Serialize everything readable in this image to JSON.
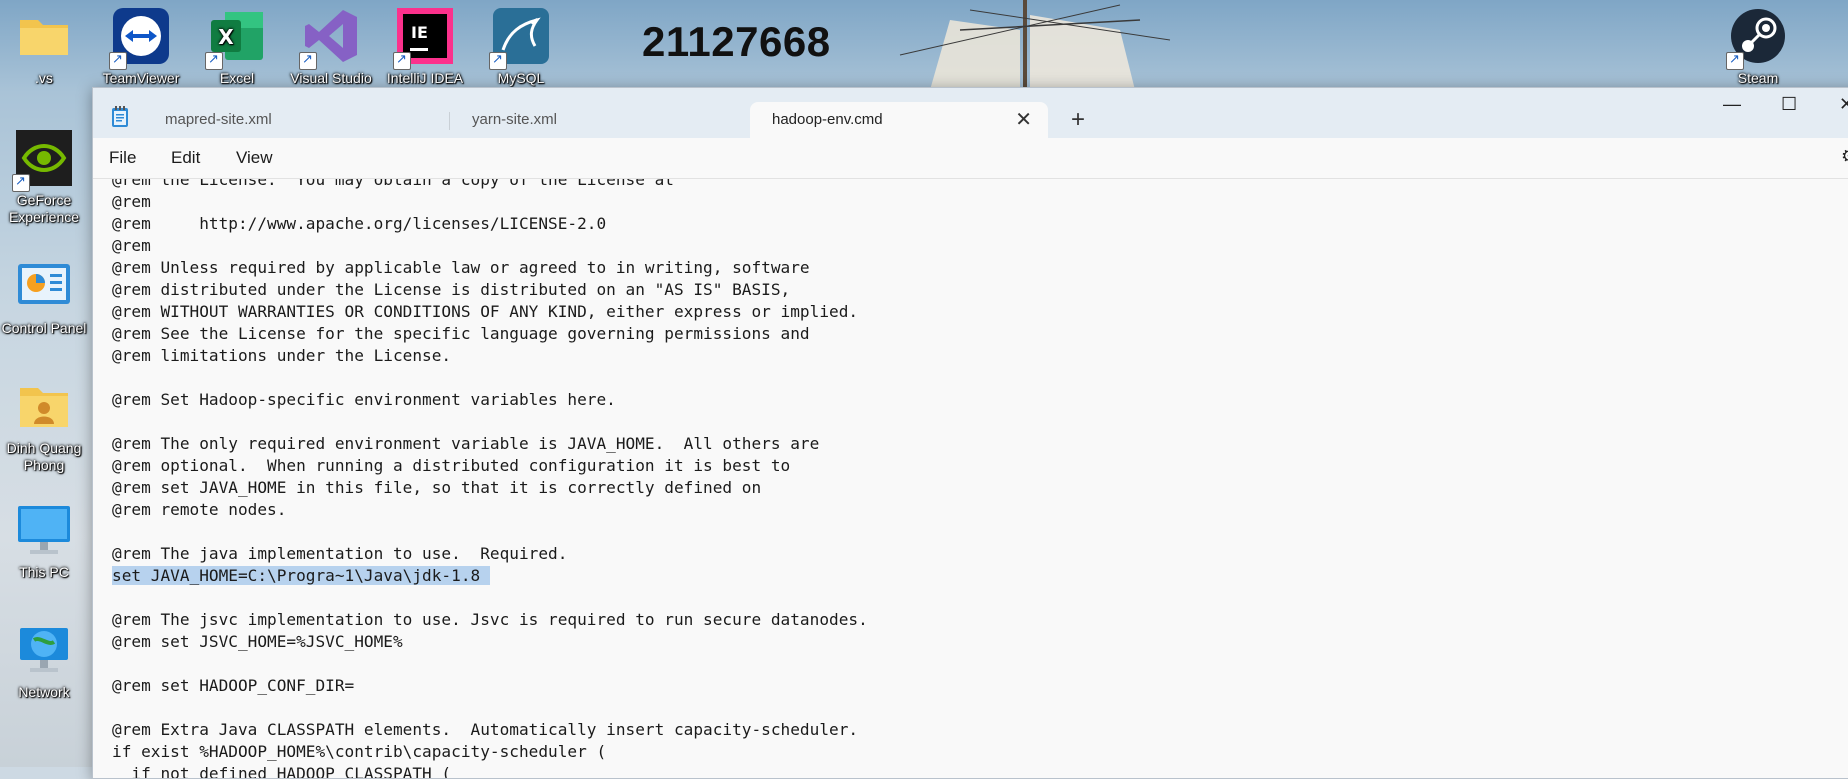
{
  "desktop": {
    "counter_text": "21127668",
    "icons": [
      {
        "label": ".vs",
        "icon": "folder-icon"
      },
      {
        "label": "TeamViewer",
        "icon": "teamviewer-icon"
      },
      {
        "label": "Excel",
        "icon": "excel-icon"
      },
      {
        "label": "Visual Studio",
        "icon": "visual-studio-icon"
      },
      {
        "label": "IntelliJ IDEA",
        "icon": "intellij-icon"
      },
      {
        "label": "MySQL",
        "icon": "mysql-icon"
      },
      {
        "label": "Steam",
        "icon": "steam-icon"
      },
      {
        "label": "GeForce Experience",
        "icon": "geforce-icon"
      },
      {
        "label": "Control Panel",
        "icon": "control-panel-icon"
      },
      {
        "label": "Dinh Quang Phong",
        "icon": "user-folder-icon"
      },
      {
        "label": "This PC",
        "icon": "monitor-icon"
      },
      {
        "label": "Network",
        "icon": "network-icon"
      }
    ]
  },
  "window": {
    "tabs": [
      {
        "label": "mapred-site.xml",
        "active": false
      },
      {
        "label": "yarn-site.xml",
        "active": false
      },
      {
        "label": "hadoop-env.cmd",
        "active": true
      }
    ],
    "new_tab_symbol": "+",
    "close_tab_symbol": "✕",
    "controls": {
      "minimize": "—",
      "maximize": "☐",
      "close": "✕"
    },
    "menu": {
      "file": "File",
      "edit": "Edit",
      "view": "View"
    },
    "settings_symbol": "⚙"
  },
  "editor": {
    "lines": [
      "@rem the License.  You may obtain a copy of the License at",
      "@rem",
      "@rem     http://www.apache.org/licenses/LICENSE-2.0",
      "@rem",
      "@rem Unless required by applicable law or agreed to in writing, software",
      "@rem distributed under the License is distributed on an \"AS IS\" BASIS,",
      "@rem WITHOUT WARRANTIES OR CONDITIONS OF ANY KIND, either express or implied.",
      "@rem See the License for the specific language governing permissions and",
      "@rem limitations under the License.",
      "",
      "@rem Set Hadoop-specific environment variables here.",
      "",
      "@rem The only required environment variable is JAVA_HOME.  All others are",
      "@rem optional.  When running a distributed configuration it is best to",
      "@rem set JAVA_HOME in this file, so that it is correctly defined on",
      "@rem remote nodes.",
      "",
      "@rem The java implementation to use.  Required.",
      "set JAVA_HOME=C:\\Progra~1\\Java\\jdk-1.8 ",
      "",
      "@rem The jsvc implementation to use. Jsvc is required to run secure datanodes.",
      "@rem set JSVC_HOME=%JSVC_HOME%",
      "",
      "@rem set HADOOP_CONF_DIR=",
      "",
      "@rem Extra Java CLASSPATH elements.  Automatically insert capacity-scheduler.",
      "if exist %HADOOP_HOME%\\contrib\\capacity-scheduler (",
      "  if not defined HADOOP_CLASSPATH ("
    ],
    "selected_line_index": 18
  }
}
